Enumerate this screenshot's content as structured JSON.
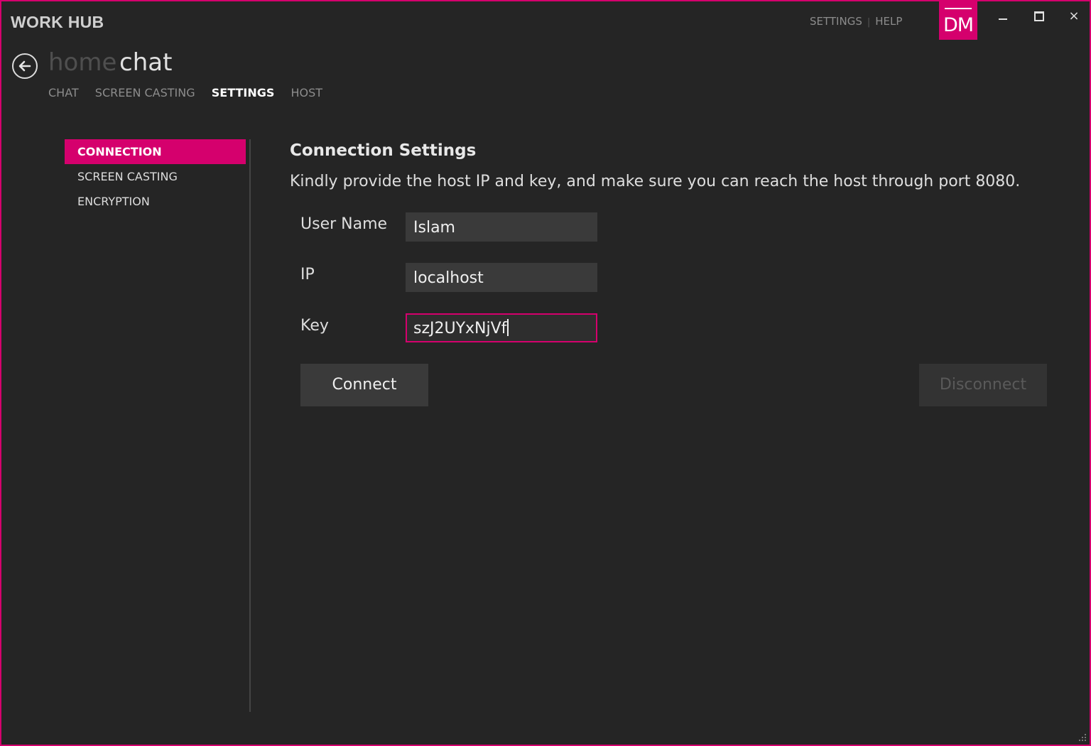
{
  "app": {
    "title": "WORK HUB"
  },
  "top_links": {
    "settings": "SETTINGS",
    "separator": "|",
    "help": "HELP"
  },
  "avatar": {
    "initials": "DM",
    "color": "#d5006d"
  },
  "window_controls": {
    "minimize": "minimize-icon",
    "maximize": "maximize-icon",
    "close": "×"
  },
  "breadcrumb": {
    "home": "home",
    "current": "chat"
  },
  "tabs": [
    {
      "label": "CHAT"
    },
    {
      "label": "SCREEN CASTING"
    },
    {
      "label": "SETTINGS",
      "active": true
    },
    {
      "label": "HOST"
    }
  ],
  "sidebar": {
    "items": [
      {
        "label": "CONNECTION",
        "active": true
      },
      {
        "label": "SCREEN CASTING"
      },
      {
        "label": "ENCRYPTION"
      }
    ]
  },
  "connection": {
    "title": "Connection Settings",
    "description": "Kindly provide the host IP and key, and make sure you can reach the host through port 8080.",
    "fields": {
      "username": {
        "label": "User Name",
        "value": "Islam"
      },
      "ip": {
        "label": "IP",
        "value": "localhost"
      },
      "key": {
        "label": "Key",
        "value": "szJ2UYxNjVf"
      }
    },
    "connect_label": "Connect",
    "disconnect_label": "Disconnect"
  },
  "accent_color": "#d5006d"
}
